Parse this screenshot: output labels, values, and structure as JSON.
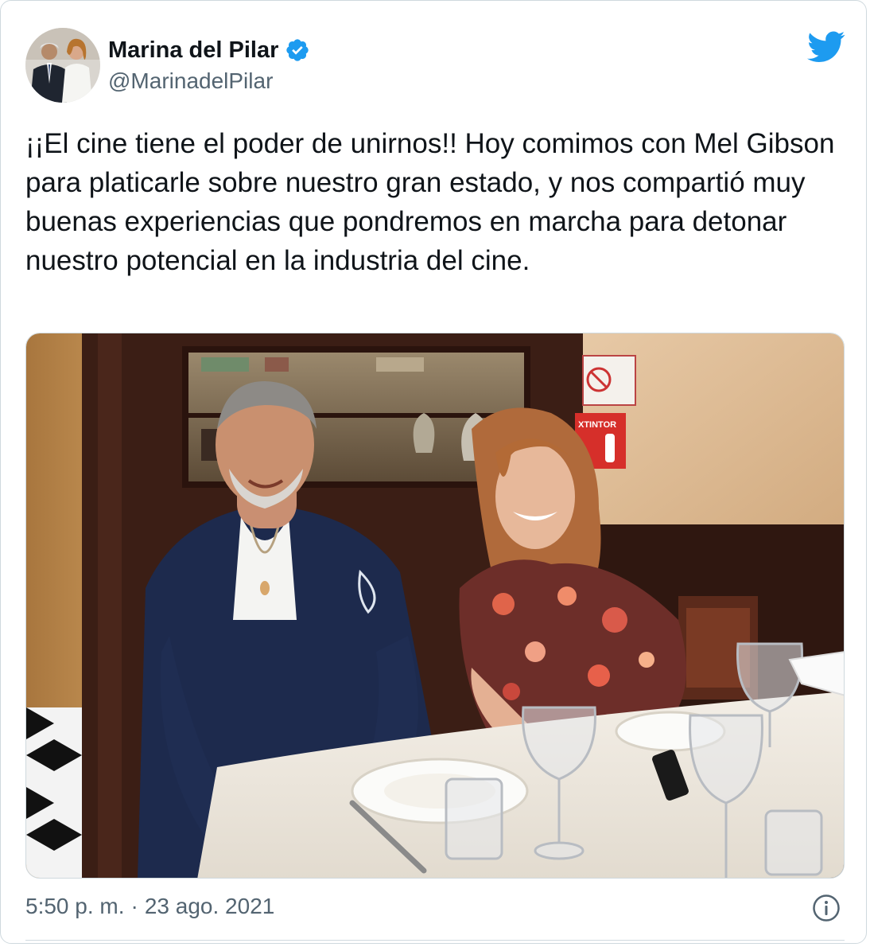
{
  "tweet": {
    "author": {
      "display_name": "Marina del Pilar",
      "handle": "@MarinadelPilar",
      "verified": true,
      "avatar_icon": "profile-photo"
    },
    "logo_icon": "twitter-bird-icon",
    "text": "¡¡El cine tiene el poder de unirnos!! Hoy comimos con Mel Gibson para platicarle sobre nuestro gran estado, y nos compartió muy buenas experiencias que pondremos en marcha para detonar nuestro potencial en la industria del cine.",
    "media": {
      "signs": {
        "extinguisher": "XTINTOR"
      }
    },
    "time": "5:50 p. m.",
    "separator": "·",
    "date": "23 ago. 2021",
    "info_icon": "info-icon"
  },
  "colors": {
    "twitter_blue": "#1d9bf0",
    "text_primary": "#0f1419",
    "text_secondary": "#536471",
    "border": "#cfd9de"
  }
}
